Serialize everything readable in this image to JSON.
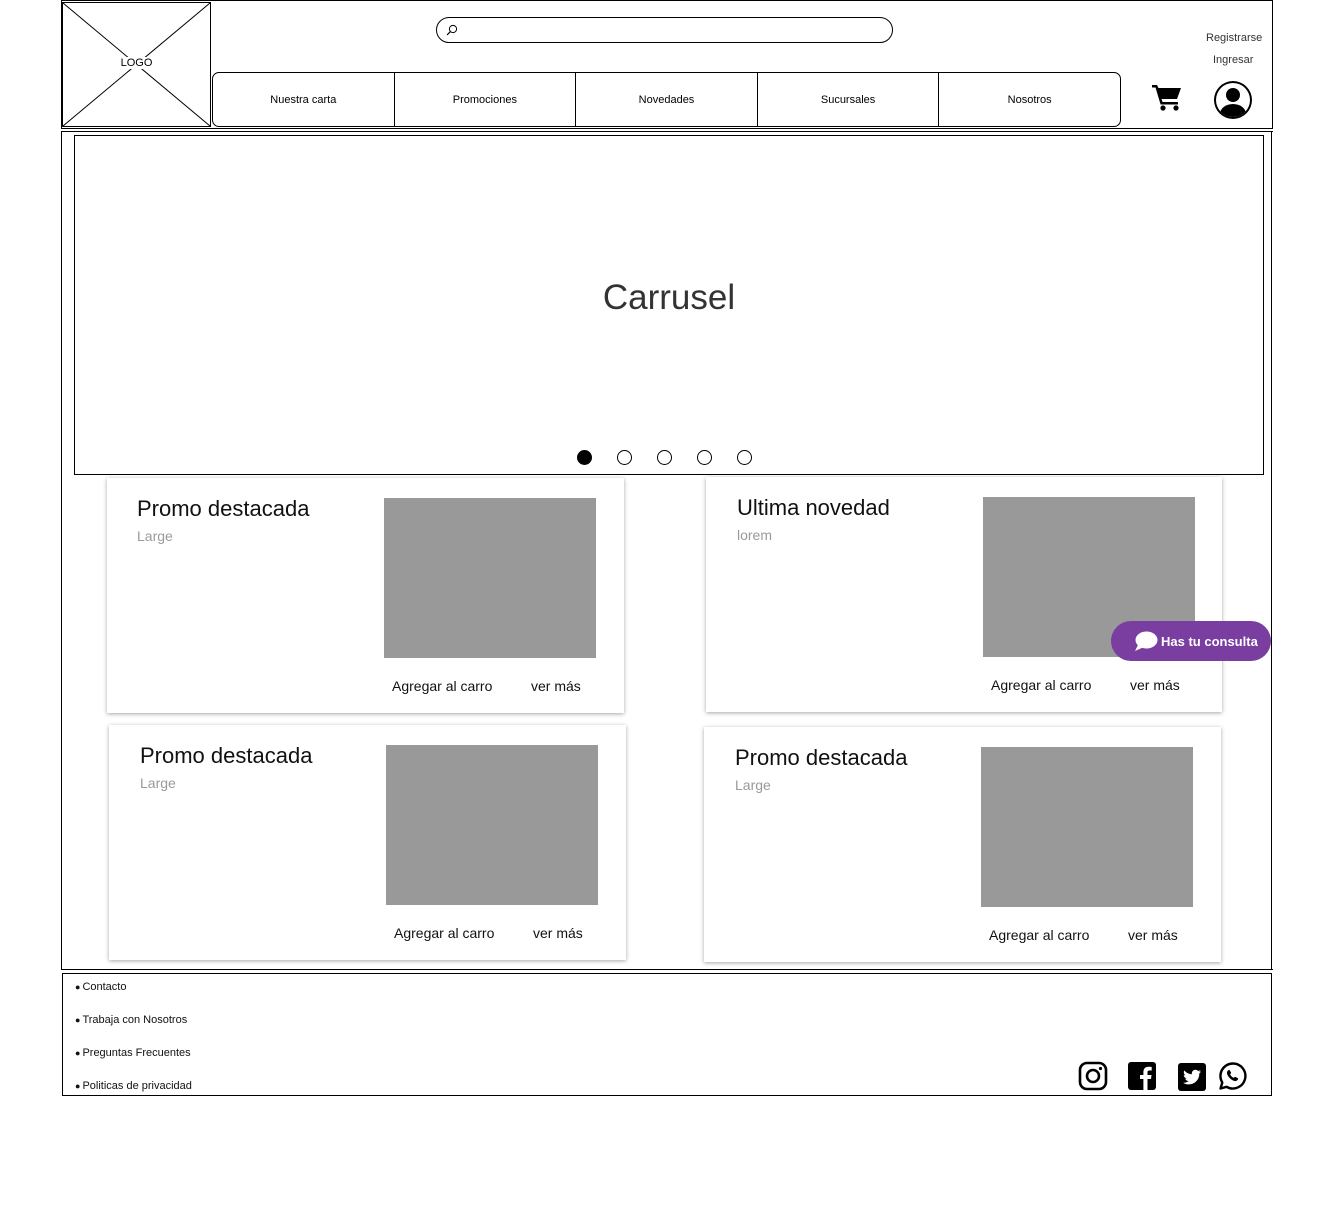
{
  "header": {
    "logo_text": "LOGO",
    "search": {
      "placeholder": "",
      "value": ""
    },
    "nav": [
      "Nuestra carta",
      "Promociones",
      "Novedades",
      "Sucursales",
      "Nosotros"
    ],
    "register_label": "Registrarse",
    "login_label": "Ingresar"
  },
  "carousel": {
    "title": "Carrusel",
    "slide_count": 5,
    "active_slide": 1
  },
  "cards": [
    {
      "title": "Promo destacada",
      "subtitle": "Large",
      "add_label": "Agregar al carro",
      "more_label": "ver más"
    },
    {
      "title": "Ultima novedad",
      "subtitle": "lorem",
      "add_label": "Agregar al carro",
      "more_label": "ver más"
    },
    {
      "title": "Promo destacada",
      "subtitle": "Large",
      "add_label": "Agregar al carro",
      "more_label": "ver más"
    },
    {
      "title": "Promo destacada",
      "subtitle": "Large",
      "add_label": "Agregar al carro",
      "more_label": "ver más"
    }
  ],
  "chat": {
    "label": "Has tu consulta",
    "color": "#7a3ea0"
  },
  "footer": {
    "links": [
      "Contacto",
      "Trabaja con Nosotros",
      "Preguntas Frecuentes",
      "Politicas de privacidad"
    ],
    "social": [
      "instagram-icon",
      "facebook-icon",
      "twitter-icon",
      "whatsapp-icon"
    ]
  },
  "colors": {
    "placeholder_image": "#999999",
    "subtitle": "#9a9a9a"
  }
}
